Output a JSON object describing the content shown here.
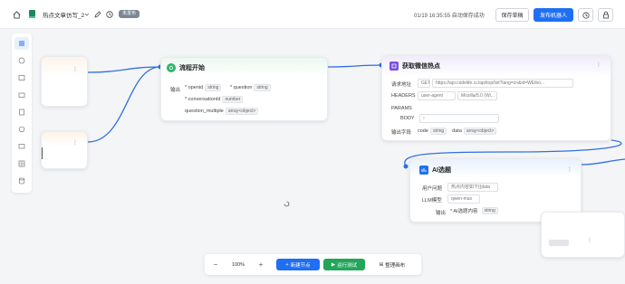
{
  "header": {
    "title": "热点文章仿写_2",
    "status_badge": "未发布",
    "timestamp": "01/19 16:35:55 自动保存成功",
    "save_label": "保存草稿",
    "publish_label": "发布机器人"
  },
  "nodes": {
    "start": {
      "title": "流程开始",
      "input_label": "输出",
      "params": [
        {
          "name": "* openid",
          "type": "string"
        },
        {
          "name": "* question",
          "type": "string"
        },
        {
          "name": "* conversationId",
          "type": "number"
        },
        {
          "name": "question_multiple",
          "type": "array<object>"
        }
      ]
    },
    "http": {
      "title": "获取微信热点",
      "url_label": "请求地址",
      "method": "GET",
      "url": "https://api.codelife.cc/api/top/list?lang=cn&id=WEibo...",
      "headers_label": "HEADERS",
      "header_key": "user-agent",
      "header_value": "Mozilla/5.0 (Wi...",
      "params_label": "PARAMS",
      "body_label": "BODY",
      "output_label": "输出字段",
      "outputs": [
        {
          "name": "code",
          "type": "string"
        },
        {
          "name": "data",
          "type": "array<object>"
        }
      ]
    },
    "ai": {
      "title": "AI选题",
      "prompt_label": "用户问题",
      "prompt_value": "热点内容如下{{data",
      "model_label": "LLM模型",
      "model_value": "qwen-max",
      "output_label": "输出",
      "output_name": "* AI选题内容",
      "output_type": "string"
    }
  },
  "toolbar": {
    "zoom": "100%",
    "minus": "−",
    "plus": "+",
    "add_node": "新建节点",
    "run": "运行测试",
    "arrange": "整理画布"
  }
}
